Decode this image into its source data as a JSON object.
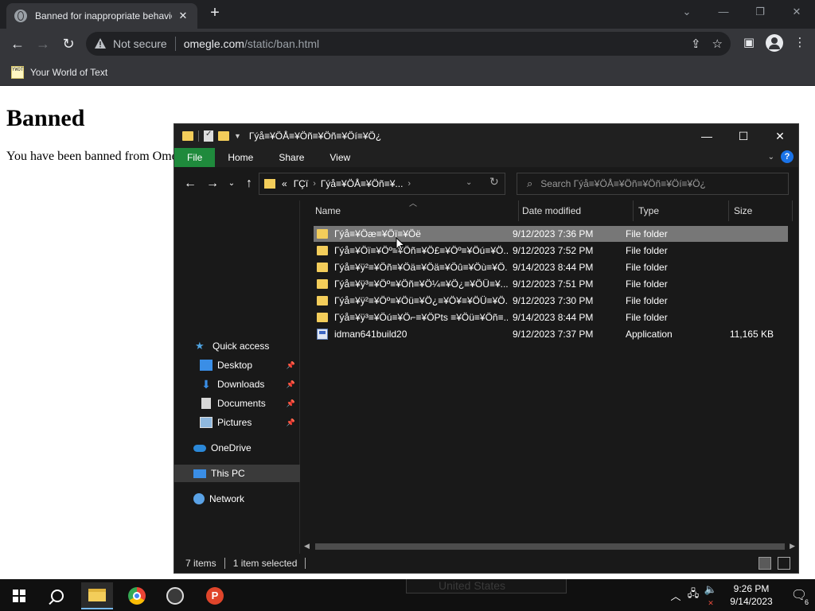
{
  "browser": {
    "tab_title": "Banned for inappropriate behavior",
    "tab_close": "✕",
    "new_tab": "+",
    "omnibox": {
      "security_label": "Not secure",
      "url_host": "omegle.com",
      "url_path": "/static/ban.html"
    },
    "bookmark": "Your World of Text",
    "bookmark_favicon": "YWOT"
  },
  "page": {
    "heading": "Banned",
    "message": "You have been banned from Ome"
  },
  "explorer": {
    "title": "Гýå≡¥ÖÅ≡¥Öñ≡¥Öñ≡¥Öí≡¥Ö¿",
    "ribbon_tabs": [
      "File",
      "Home",
      "Share",
      "View"
    ],
    "address": {
      "prefix": "«",
      "crumb1": "ГÇï",
      "crumb2": "Гýå≡¥ÖÅ≡¥Öñ≡¥..."
    },
    "search_placeholder": "Search Гýå≡¥ÖÅ≡¥Öñ≡¥Öñ≡¥Öí≡¥Ö¿",
    "nav_pane": {
      "quick_access": "Quick access",
      "desktop": "Desktop",
      "downloads": "Downloads",
      "documents": "Documents",
      "pictures": "Pictures",
      "onedrive": "OneDrive",
      "this_pc": "This PC",
      "network": "Network"
    },
    "columns": {
      "name": "Name",
      "date": "Date modified",
      "type": "Type",
      "size": "Size"
    },
    "files": [
      {
        "name": "Гýå≡¥Öæ≡¥Öï≡¥Öë",
        "date": "9/12/2023 7:36 PM",
        "type": "File folder",
        "size": ""
      },
      {
        "name": "Гýå≡¥Öï≡¥Öº≡¥Öñ≡¥Ö£≡¥Öº≡¥Öú≡¥Ö...",
        "date": "9/12/2023 7:52 PM",
        "type": "File folder",
        "size": ""
      },
      {
        "name": "Гýå≡¥ÿ²≡¥Öñ≡¥Öä≡¥Öä≡¥Öû≡¥Öù≡¥Ö...",
        "date": "9/14/2023 8:44 PM",
        "type": "File folder",
        "size": ""
      },
      {
        "name": "Гýå≡¥ÿ³≡¥Öº≡¥Öñ≡¥Ö¼≡¥Ö¿≡¥ÖÜ≡¥...",
        "date": "9/12/2023 7:51 PM",
        "type": "File folder",
        "size": ""
      },
      {
        "name": "Гýå≡¥ÿ²≡¥Öº≡¥Öü≡¥Ö¿≡¥Ö¥≡¥ÖÜ≡¥Ö...",
        "date": "9/12/2023 7:30 PM",
        "type": "File folder",
        "size": ""
      },
      {
        "name": "Гýå≡¥ÿ³≡¥Öú≡¥Ö⌐≡¥ÖPts ≡¥Öü≡¥Öñ≡...",
        "date": "9/14/2023 8:44 PM",
        "type": "File folder",
        "size": ""
      },
      {
        "name": "idman641build20",
        "date": "9/12/2023 7:37 PM",
        "type": "Application",
        "size": "11,165 KB"
      }
    ],
    "status": {
      "items": "7 items",
      "selected": "1 item selected"
    }
  },
  "taskbar": {
    "ghost_text": "United States",
    "clock_time": "9:26 PM",
    "clock_date": "9/14/2023",
    "notification_count": "6"
  },
  "icons": {
    "tab_favicon": "globe-icon",
    "warning": "warning-triangle-icon",
    "share": "share-icon",
    "star": "star-icon",
    "sidebar": "side-panel-icon",
    "profile": "profile-icon",
    "menu": "kebab-menu-icon"
  },
  "colors": {
    "chrome_dark": "#202124",
    "chrome_toolbar": "#35363a",
    "explorer_bg": "#191919",
    "ribbon_file": "#1f8a3c",
    "folder": "#f3cd5a",
    "selection": "#777777"
  }
}
